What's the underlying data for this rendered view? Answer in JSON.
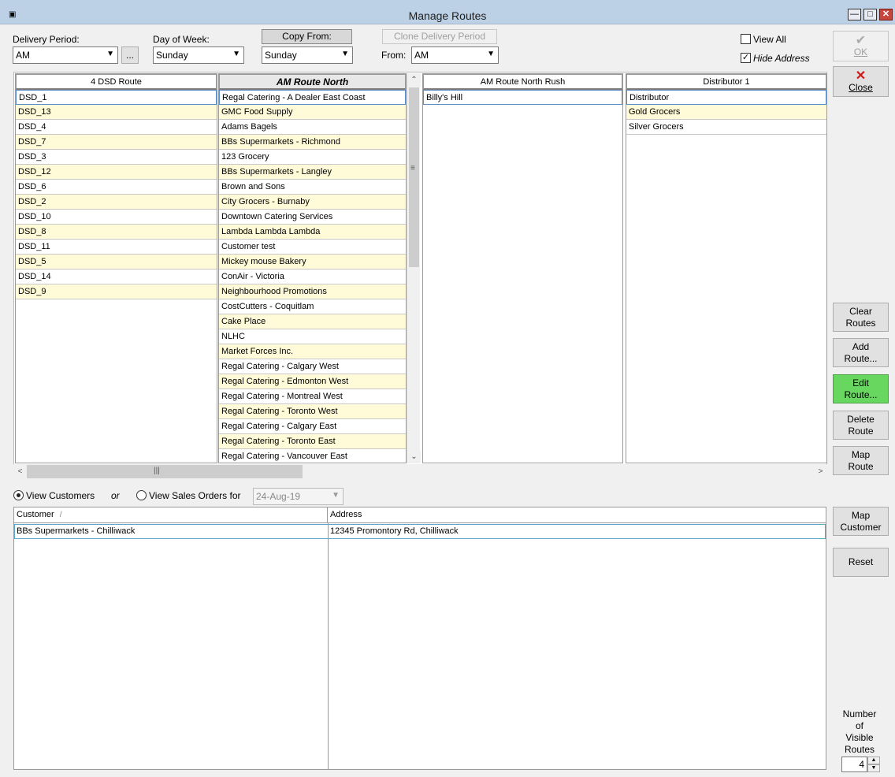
{
  "window": {
    "title": "Manage Routes"
  },
  "top": {
    "delivery_period_label": "Delivery Period:",
    "delivery_period_value": "AM",
    "ellipsis_label": "...",
    "day_of_week_label": "Day of Week:",
    "day_of_week_value": "Sunday",
    "copy_from_label": "Copy From:",
    "copy_from_value": "Sunday",
    "clone_label": "Clone Delivery Period",
    "from_label": "From:",
    "from_value": "AM",
    "view_all_label": "View All",
    "view_all_checked": false,
    "hide_address_label": "Hide Address",
    "hide_address_checked": true
  },
  "side_buttons": {
    "ok": "OK",
    "close": "Close",
    "clear_routes": [
      "Clear",
      "Routes"
    ],
    "add_route": [
      "Add",
      "Route..."
    ],
    "edit_route": [
      "Edit",
      "Route..."
    ],
    "delete_route": [
      "Delete",
      "Route"
    ],
    "map_route": [
      "Map",
      "Route"
    ],
    "map_customer": [
      "Map",
      "Customer"
    ],
    "reset": "Reset",
    "visible_routes_label": [
      "Number",
      "of",
      "Visible",
      "Routes"
    ],
    "visible_routes_value": "4"
  },
  "routes": [
    {
      "name": "4 DSD Route",
      "items": [
        "DSD_1",
        "DSD_13",
        "DSD_4",
        "DSD_7",
        "DSD_3",
        "DSD_12",
        "DSD_6",
        "DSD_2",
        "DSD_10",
        "DSD_8",
        "DSD_11",
        "DSD_5",
        "DSD_14",
        "DSD_9"
      ]
    },
    {
      "name": "AM Route North",
      "items": [
        "Regal Catering - A Dealer East Coast",
        "GMC Food Supply",
        "Adams Bagels",
        "BBs Supermarkets - Richmond",
        "123 Grocery",
        "BBs Supermarkets - Langley",
        "Brown and Sons",
        "City Grocers - Burnaby",
        "Downtown Catering Services",
        "Lambda Lambda Lambda",
        "Customer test",
        "Mickey mouse Bakery",
        "ConAir - Victoria",
        "Neighbourhood Promotions",
        "CostCutters - Coquitlam",
        "Cake Place",
        "NLHC",
        "Market Forces Inc.",
        "Regal Catering - Calgary West",
        "Regal Catering - Edmonton West",
        "Regal Catering - Montreal West",
        "Regal Catering - Toronto West",
        "Regal Catering - Calgary East",
        "Regal Catering - Toronto East",
        "Regal Catering - Vancouver East"
      ]
    },
    {
      "name": "AM Route North Rush",
      "items": [
        "Billy's Hill"
      ]
    },
    {
      "name": "Distributor 1",
      "items": [
        "Distributor",
        "Gold Grocers",
        "Silver Grocers"
      ]
    }
  ],
  "view": {
    "view_customers_label": "View Customers",
    "or_label": "or",
    "view_sales_orders_label": "View Sales Orders for",
    "date_value": "24-Aug-19",
    "selected": "customers"
  },
  "grid": {
    "columns": [
      "Customer",
      "Address"
    ],
    "sort_indicator": "/",
    "rows": [
      {
        "customer": "BBs Supermarkets - Chilliwack",
        "address": "12345 Promontory Rd, Chilliwack"
      }
    ]
  },
  "colors": {
    "row_alt": "#fffbd9",
    "edit_button": "#67d760",
    "title_bar": "#bcd0e6"
  }
}
